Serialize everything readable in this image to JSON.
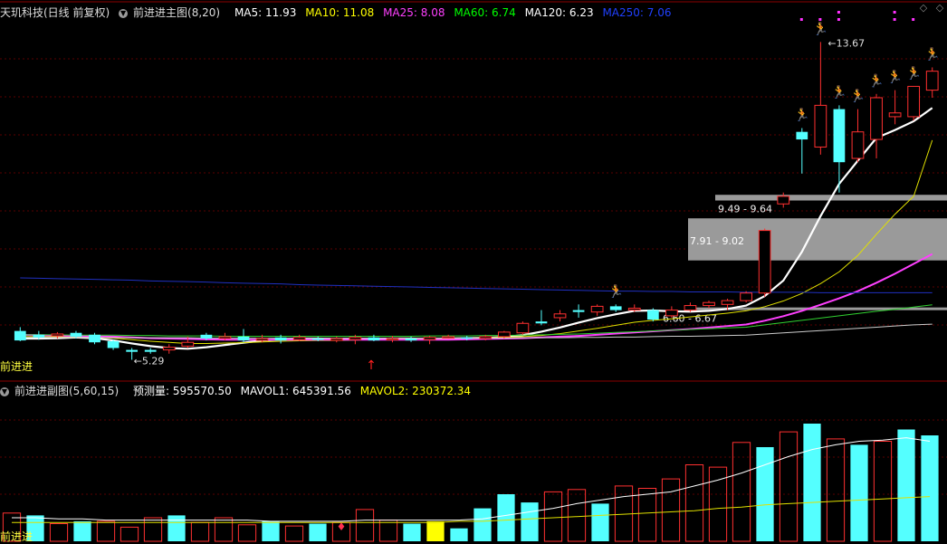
{
  "main_header": {
    "stock": "天玑科技(日线 前复权)",
    "indicator": "前进进主图(8,20)",
    "ma": [
      {
        "label": "MA5: 11.93",
        "color": "#ffffff"
      },
      {
        "label": "MA10: 11.08",
        "color": "#ffff00"
      },
      {
        "label": "MA25: 8.08",
        "color": "#ff40ff"
      },
      {
        "label": "MA60: 6.74",
        "color": "#00ff00"
      },
      {
        "label": "MA120: 6.23",
        "color": "#ffffff"
      },
      {
        "label": "MA250: 7.06",
        "color": "#2040ff"
      }
    ]
  },
  "sub_header": {
    "indicator": "前进进副图(5,60,15)",
    "items": [
      {
        "label": "预测量: 595570.50",
        "color": "#ffffff"
      },
      {
        "label": "MAVOL1: 645391.56",
        "color": "#ffffff"
      },
      {
        "label": "MAVOL2: 230372.34",
        "color": "#ffff00"
      }
    ]
  },
  "labels": {
    "main_name": "前进进",
    "sub_name": "前进进"
  },
  "chart_data": {
    "type": "candlestick",
    "y_range": [
      4.8,
      14.3
    ],
    "annotations": {
      "high_label": "13.67",
      "low_label": "5.29",
      "zone1": "9.49 - 9.64",
      "zone2": "7.91 - 9.02",
      "zone3": "6.60 - 6.67"
    },
    "candles": [
      [
        6.05,
        5.8,
        5.78,
        6.15
      ],
      [
        5.95,
        5.88,
        5.82,
        6.05
      ],
      [
        5.92,
        5.97,
        5.85,
        6.02
      ],
      [
        6.0,
        5.9,
        5.85,
        6.05
      ],
      [
        5.95,
        5.75,
        5.7,
        6.0
      ],
      [
        5.78,
        5.6,
        5.55,
        5.82
      ],
      [
        5.55,
        5.5,
        5.29,
        5.6
      ],
      [
        5.55,
        5.5,
        5.45,
        5.6
      ],
      [
        5.55,
        5.62,
        5.45,
        5.7
      ],
      [
        5.65,
        5.75,
        5.6,
        5.9
      ],
      [
        5.95,
        5.85,
        5.8,
        6.0
      ],
      [
        5.85,
        5.9,
        5.8,
        6.0
      ],
      [
        5.9,
        5.8,
        5.75,
        6.1
      ],
      [
        5.8,
        5.85,
        5.75,
        5.95
      ],
      [
        5.88,
        5.8,
        5.72,
        5.95
      ],
      [
        5.82,
        5.88,
        5.78,
        5.95
      ],
      [
        5.85,
        5.82,
        5.78,
        5.9
      ],
      [
        5.8,
        5.85,
        5.75,
        5.9
      ],
      [
        5.82,
        5.88,
        5.7,
        5.95
      ],
      [
        5.88,
        5.8,
        5.78,
        5.95
      ],
      [
        5.82,
        5.85,
        5.75,
        5.92
      ],
      [
        5.85,
        5.8,
        5.76,
        5.9
      ],
      [
        5.82,
        5.88,
        5.7,
        5.92
      ],
      [
        5.88,
        5.9,
        5.85,
        5.95
      ],
      [
        5.88,
        5.85,
        5.8,
        5.92
      ],
      [
        5.85,
        5.9,
        5.8,
        5.95
      ],
      [
        5.9,
        6.02,
        5.85,
        6.05
      ],
      [
        6.0,
        6.25,
        5.95,
        6.3
      ],
      [
        6.3,
        6.25,
        6.2,
        6.6
      ],
      [
        6.4,
        6.5,
        6.3,
        6.6
      ],
      [
        6.6,
        6.55,
        6.4,
        6.75
      ],
      [
        6.55,
        6.7,
        6.45,
        6.75
      ],
      [
        6.7,
        6.6,
        6.55,
        6.75
      ],
      [
        6.6,
        6.65,
        6.55,
        6.75
      ],
      [
        6.6,
        6.35,
        6.3,
        6.65
      ],
      [
        6.45,
        6.6,
        6.4,
        6.7
      ],
      [
        6.6,
        6.72,
        6.55,
        6.8
      ],
      [
        6.72,
        6.8,
        6.65,
        6.85
      ],
      [
        6.75,
        6.85,
        6.6,
        6.9
      ],
      [
        6.85,
        7.05,
        6.8,
        7.1
      ],
      [
        7.05,
        8.7,
        6.95,
        8.75
      ],
      [
        9.4,
        9.6,
        9.3,
        9.7
      ],
      [
        11.3,
        11.1,
        10.2,
        11.4
      ],
      [
        10.9,
        12.0,
        10.7,
        13.67
      ],
      [
        11.9,
        10.5,
        9.7,
        12.0
      ],
      [
        10.6,
        11.3,
        10.5,
        11.9
      ],
      [
        11.1,
        12.2,
        10.6,
        12.3
      ],
      [
        11.7,
        11.8,
        11.5,
        12.4
      ],
      [
        11.7,
        12.5,
        11.6,
        12.5
      ],
      [
        12.4,
        12.9,
        12.2,
        13.0
      ]
    ],
    "ma_series": {
      "MA5": [
        5.85,
        5.85,
        5.86,
        5.88,
        5.86,
        5.8,
        5.72,
        5.65,
        5.6,
        5.58,
        5.62,
        5.68,
        5.74,
        5.8,
        5.83,
        5.85,
        5.85,
        5.84,
        5.84,
        5.84,
        5.85,
        5.85,
        5.84,
        5.85,
        5.86,
        5.87,
        5.89,
        5.94,
        6.03,
        6.14,
        6.27,
        6.39,
        6.49,
        6.58,
        6.59,
        6.57,
        6.56,
        6.58,
        6.63,
        6.72,
        6.97,
        7.38,
        8.14,
        9.08,
        9.93,
        10.54,
        11.14,
        11.35,
        11.58,
        11.93
      ],
      "MA10": [
        5.9,
        5.9,
        5.9,
        5.89,
        5.88,
        5.86,
        5.82,
        5.78,
        5.75,
        5.72,
        5.72,
        5.73,
        5.74,
        5.76,
        5.78,
        5.79,
        5.8,
        5.8,
        5.81,
        5.82,
        5.83,
        5.84,
        5.85,
        5.85,
        5.86,
        5.87,
        5.88,
        5.9,
        5.93,
        5.98,
        6.05,
        6.12,
        6.2,
        6.28,
        6.33,
        6.37,
        6.42,
        6.47,
        6.52,
        6.58,
        6.69,
        6.84,
        7.04,
        7.3,
        7.61,
        8.04,
        8.6,
        9.13,
        9.6,
        11.08
      ],
      "MA25": [
        5.95,
        5.94,
        5.93,
        5.92,
        5.91,
        5.9,
        5.88,
        5.86,
        5.85,
        5.84,
        5.83,
        5.82,
        5.82,
        5.82,
        5.82,
        5.82,
        5.82,
        5.82,
        5.82,
        5.82,
        5.82,
        5.82,
        5.82,
        5.82,
        5.83,
        5.84,
        5.85,
        5.86,
        5.88,
        5.9,
        5.92,
        5.95,
        5.98,
        6.01,
        6.04,
        6.07,
        6.1,
        6.14,
        6.18,
        6.22,
        6.32,
        6.44,
        6.58,
        6.74,
        6.91,
        7.1,
        7.32,
        7.56,
        7.82,
        8.08
      ],
      "MA60": [
        5.95,
        5.95,
        5.95,
        5.94,
        5.94,
        5.94,
        5.93,
        5.93,
        5.92,
        5.92,
        5.92,
        5.91,
        5.91,
        5.91,
        5.91,
        5.91,
        5.91,
        5.91,
        5.91,
        5.91,
        5.91,
        5.91,
        5.92,
        5.92,
        5.92,
        5.93,
        5.93,
        5.94,
        5.95,
        5.96,
        5.97,
        5.99,
        6.01,
        6.03,
        6.05,
        6.07,
        6.09,
        6.11,
        6.13,
        6.15,
        6.21,
        6.27,
        6.33,
        6.39,
        6.45,
        6.51,
        6.57,
        6.62,
        6.68,
        6.74
      ],
      "MA120": [
        5.88,
        5.88,
        5.88,
        5.88,
        5.88,
        5.87,
        5.87,
        5.87,
        5.87,
        5.87,
        5.86,
        5.86,
        5.86,
        5.86,
        5.86,
        5.86,
        5.86,
        5.86,
        5.86,
        5.86,
        5.86,
        5.86,
        5.86,
        5.86,
        5.86,
        5.86,
        5.86,
        5.87,
        5.87,
        5.87,
        5.88,
        5.88,
        5.89,
        5.89,
        5.9,
        5.91,
        5.91,
        5.92,
        5.93,
        5.94,
        5.97,
        6.0,
        6.03,
        6.06,
        6.09,
        6.12,
        6.15,
        6.18,
        6.21,
        6.23
      ],
      "MA250": [
        7.45,
        7.44,
        7.43,
        7.42,
        7.41,
        7.4,
        7.39,
        7.37,
        7.36,
        7.35,
        7.34,
        7.32,
        7.31,
        7.3,
        7.29,
        7.27,
        7.26,
        7.25,
        7.24,
        7.23,
        7.22,
        7.21,
        7.2,
        7.19,
        7.18,
        7.17,
        7.16,
        7.15,
        7.14,
        7.13,
        7.12,
        7.11,
        7.1,
        7.1,
        7.09,
        7.09,
        7.08,
        7.08,
        7.08,
        7.07,
        7.07,
        7.07,
        7.07,
        7.06,
        7.06,
        7.06,
        7.06,
        7.06,
        7.06,
        7.06
      ]
    },
    "volume": [
      0.24,
      0.22,
      0.15,
      0.17,
      0.17,
      0.12,
      0.2,
      0.22,
      0.16,
      0.2,
      0.14,
      0.17,
      0.13,
      0.15,
      0.16,
      0.27,
      0.18,
      0.15,
      0.17,
      0.11,
      0.28,
      0.4,
      0.33,
      0.42,
      0.44,
      0.32,
      0.47,
      0.45,
      0.53,
      0.65,
      0.63,
      0.84,
      0.8,
      0.93,
      1.0,
      0.87,
      0.82,
      0.85,
      0.95,
      0.9
    ],
    "vol_mavol1": [
      0.2,
      0.2,
      0.19,
      0.19,
      0.18,
      0.18,
      0.18,
      0.18,
      0.18,
      0.18,
      0.18,
      0.17,
      0.17,
      0.17,
      0.17,
      0.18,
      0.18,
      0.18,
      0.18,
      0.18,
      0.19,
      0.22,
      0.25,
      0.28,
      0.32,
      0.35,
      0.38,
      0.4,
      0.42,
      0.47,
      0.52,
      0.58,
      0.65,
      0.72,
      0.78,
      0.82,
      0.85,
      0.86,
      0.88,
      0.85
    ],
    "vol_mavol2": [
      0.16,
      0.16,
      0.16,
      0.16,
      0.16,
      0.16,
      0.16,
      0.16,
      0.16,
      0.16,
      0.16,
      0.16,
      0.16,
      0.16,
      0.16,
      0.16,
      0.16,
      0.16,
      0.16,
      0.17,
      0.17,
      0.18,
      0.19,
      0.2,
      0.21,
      0.22,
      0.23,
      0.24,
      0.25,
      0.26,
      0.28,
      0.29,
      0.31,
      0.32,
      0.33,
      0.34,
      0.35,
      0.36,
      0.37,
      0.38
    ]
  }
}
